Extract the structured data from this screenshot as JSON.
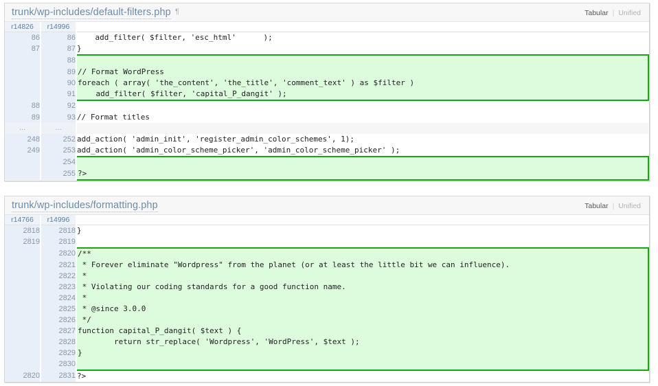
{
  "view_toggles": {
    "tabular_label": "Tabular",
    "unified_label": "Unified",
    "separator": "|",
    "active": "Tabular"
  },
  "colors": {
    "added_background": "#ddfcdd",
    "added_border": "#17a417",
    "gutter_background": "#e9eff8",
    "gutter_text": "#8897a8",
    "title_link": "#6a8cad",
    "panel_background": "#ffffff",
    "header_background": "#f7f7f7"
  },
  "panels": [
    {
      "title": "trunk/wp-includes/default-filters.php",
      "anchor_mark": "¶",
      "old_rev_label": "r14826",
      "new_rev_label": "r14996",
      "rows": [
        {
          "old": "86",
          "new": "86",
          "type": "ctx",
          "code": "    add_filter( $filter, 'esc_html'      );"
        },
        {
          "old": "87",
          "new": "87",
          "type": "ctx",
          "code": "}"
        },
        {
          "old": "",
          "new": "88",
          "type": "add",
          "code": ""
        },
        {
          "old": "",
          "new": "89",
          "type": "add",
          "code": "// Format WordPress"
        },
        {
          "old": "",
          "new": "90",
          "type": "add",
          "code": "foreach ( array( 'the_content', 'the_title', 'comment_text' ) as $filter )"
        },
        {
          "old": "",
          "new": "91",
          "type": "add",
          "code": "    add_filter( $filter, 'capital_P_dangit' );"
        },
        {
          "old": "88",
          "new": "92",
          "type": "ctx",
          "code": ""
        },
        {
          "old": "89",
          "new": "93",
          "type": "ctx",
          "code": "// Format titles"
        },
        {
          "old": "…",
          "new": "…",
          "type": "skip",
          "code": ""
        },
        {
          "old": "248",
          "new": "252",
          "type": "ctx",
          "code": "add_action( 'admin_init', 'register_admin_color_schemes', 1);"
        },
        {
          "old": "249",
          "new": "253",
          "type": "ctx",
          "code": "add_action( 'admin_color_scheme_picker', 'admin_color_scheme_picker' );"
        },
        {
          "old": "",
          "new": "254",
          "type": "add",
          "code": ""
        },
        {
          "old": "",
          "new": "255",
          "type": "add",
          "code": "?>"
        }
      ]
    },
    {
      "title": "trunk/wp-includes/formatting.php",
      "anchor_mark": "",
      "old_rev_label": "r14766",
      "new_rev_label": "r14996",
      "rows": [
        {
          "old": "2818",
          "new": "2818",
          "type": "ctx",
          "code": "}"
        },
        {
          "old": "2819",
          "new": "2819",
          "type": "ctx",
          "code": ""
        },
        {
          "old": "",
          "new": "2820",
          "type": "add",
          "code": "/**"
        },
        {
          "old": "",
          "new": "2821",
          "type": "add",
          "code": " * Forever eliminate \"Wordpress\" from the planet (or at least the little bit we can influence)."
        },
        {
          "old": "",
          "new": "2822",
          "type": "add",
          "code": " *"
        },
        {
          "old": "",
          "new": "2823",
          "type": "add",
          "code": " * Violating our coding standards for a good function name."
        },
        {
          "old": "",
          "new": "2824",
          "type": "add",
          "code": " *"
        },
        {
          "old": "",
          "new": "2825",
          "type": "add",
          "code": " * @since 3.0.0"
        },
        {
          "old": "",
          "new": "2826",
          "type": "add",
          "code": " */"
        },
        {
          "old": "",
          "new": "2827",
          "type": "add",
          "code": "function capital_P_dangit( $text ) {"
        },
        {
          "old": "",
          "new": "2828",
          "type": "add",
          "code": "        return str_replace( 'Wordpress', 'WordPress', $text );"
        },
        {
          "old": "",
          "new": "2829",
          "type": "add",
          "code": "}"
        },
        {
          "old": "",
          "new": "2830",
          "type": "add",
          "code": ""
        },
        {
          "old": "2820",
          "new": "2831",
          "type": "ctx",
          "code": "?>"
        }
      ]
    }
  ]
}
